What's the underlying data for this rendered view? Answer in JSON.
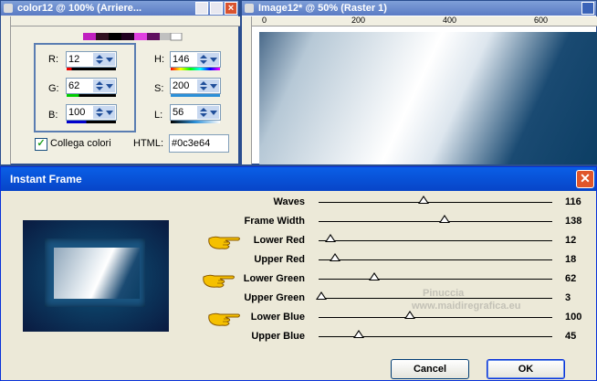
{
  "color_window": {
    "title": "color12 @ 100% (Arriere...",
    "labels": {
      "r": "R:",
      "g": "G:",
      "b": "B:",
      "h": "H:",
      "s": "S:",
      "l": "L:"
    },
    "values": {
      "r": "12",
      "g": "62",
      "b": "100",
      "h": "146",
      "s": "200",
      "l": "56"
    },
    "link_label": "Collega colori",
    "link_checked": true,
    "html_label": "HTML:",
    "html_value": "#0c3e64"
  },
  "image_window": {
    "title": "Image12* @ 50% (Raster 1)",
    "ruler_labels": [
      "0",
      "200",
      "400",
      "600"
    ]
  },
  "dialog": {
    "title": "Instant Frame",
    "params": [
      {
        "label": "Waves",
        "value": "116",
        "pos": 0.45,
        "pointer": false
      },
      {
        "label": "Frame Width",
        "value": "138",
        "pos": 0.54,
        "pointer": false
      },
      {
        "label": "Lower Red",
        "value": "12",
        "pos": 0.05,
        "pointer": true
      },
      {
        "label": "Upper Red",
        "value": "18",
        "pos": 0.07,
        "pointer": false
      },
      {
        "label": "Lower Green",
        "value": "62",
        "pos": 0.24,
        "pointer": true
      },
      {
        "label": "Upper Green",
        "value": "3",
        "pos": 0.01,
        "pointer": false
      },
      {
        "label": "Lower Blue",
        "value": "100",
        "pos": 0.39,
        "pointer": true
      },
      {
        "label": "Upper Blue",
        "value": "45",
        "pos": 0.17,
        "pointer": false
      }
    ],
    "cancel_label": "Cancel",
    "ok_label": "OK",
    "watermark_line1": "Pinuccia",
    "watermark_line2": "www.maidiregrafica.eu"
  },
  "colors": {
    "frame_color": "#0c3e64",
    "dark_navy": "#0a1a40"
  }
}
